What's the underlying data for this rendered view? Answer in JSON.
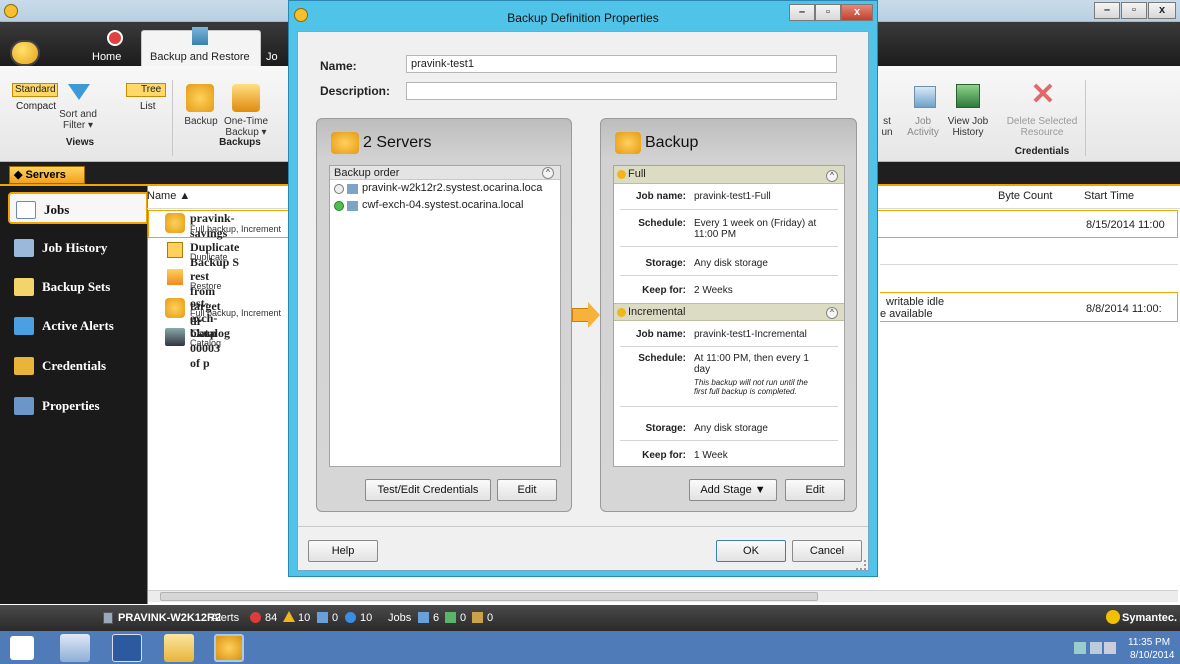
{
  "app": {
    "tabs": [
      "Home",
      "Backup and Restore",
      "Jo"
    ],
    "ribbon": {
      "views": {
        "standard": "Standard",
        "compact": "Compact",
        "sort": "Sort and",
        "filter": "Filter ▾",
        "tree": "Tree",
        "list": "List",
        "title": "Views"
      },
      "backups": {
        "backup": "Backup",
        "one_time": "One-Time",
        "one_time2": "Backup ▾",
        "title": "Backups"
      },
      "right": {
        "job_activity": "Job",
        "job_activity2": "Activity",
        "view_job": "View Job",
        "view_job2": "History",
        "delete": "Delete Selected",
        "delete2": "Resource",
        "cred_title": "Credentials",
        "st": "st",
        "un": "un"
      }
    },
    "nav_button": "Servers",
    "sidebar": [
      "Jobs",
      "Job History",
      "Backup Sets",
      "Active Alerts",
      "Credentials",
      "Properties"
    ],
    "columns": {
      "name": "Name ▲",
      "byte_count": "Byte Count",
      "start_time": "Start Time"
    },
    "rows": [
      {
        "name": "pravink-savings",
        "sub": "Full backup, Increment",
        "start": "8/15/2014 11:00"
      },
      {
        "name": "Duplicate Backup S",
        "sub": "Duplicate",
        "start": ""
      },
      {
        "name": "rest from target dr",
        "sub": "Restore",
        "start": ""
      },
      {
        "name": "ost-exch-bkup",
        "sub": "Full backup, Increment",
        "status1": "writable idle",
        "status2": "e available",
        "start": "8/8/2014 11:00:"
      },
      {
        "name": "Catalog 00003 of p",
        "sub": "Catalog",
        "start": ""
      }
    ],
    "statusbar": {
      "server": "PRAVINK-W2K12R2",
      "alerts": "Alerts",
      "a1": "84",
      "a2": "10",
      "a3": "0",
      "a4": "10",
      "jobs": "Jobs",
      "j1": "6",
      "j2": "0",
      "j3": "0"
    },
    "brand": "Symantec.",
    "clock": {
      "time": "11:35 PM",
      "date": "8/10/2014"
    }
  },
  "dialog": {
    "title": "Backup Definition Properties",
    "name_label": "Name:",
    "name_value": "pravink-test1",
    "desc_label": "Description:",
    "desc_value": "",
    "servers": {
      "header": "2 Servers",
      "order_label": "Backup order",
      "items": [
        "pravink-w2k12r2.systest.ocarina.loca",
        "cwf-exch-04.systest.ocarina.local"
      ],
      "btn_creds": "Test/Edit Credentials",
      "btn_edit": "Edit"
    },
    "backup": {
      "header": "Backup",
      "full": {
        "title": "Full",
        "job_label": "Job name:",
        "job": "pravink-test1-Full",
        "sched_label": "Schedule:",
        "sched1": "Every 1 week on (Friday) at",
        "sched2": "11:00 PM",
        "storage_label": "Storage:",
        "storage": "Any disk storage",
        "keep_label": "Keep for:",
        "keep": "2 Weeks"
      },
      "incr": {
        "title": "Incremental",
        "job_label": "Job name:",
        "job": "pravink-test1-Incremental",
        "sched_label": "Schedule:",
        "sched1": "At 11:00 PM, then every 1",
        "sched2": "day",
        "note1": "This backup will not run until the",
        "note2": "first full backup is completed.",
        "storage_label": "Storage:",
        "storage": "Any disk storage",
        "keep_label": "Keep for:",
        "keep": "1 Week"
      },
      "btn_add": "Add Stage ▼",
      "btn_edit": "Edit"
    },
    "btn_help": "Help",
    "btn_ok": "OK",
    "btn_cancel": "Cancel"
  },
  "colors": {
    "accent": "#f2a400",
    "dialog_frame": "#4fc3e8",
    "taskbar": "#4f7bb8"
  }
}
